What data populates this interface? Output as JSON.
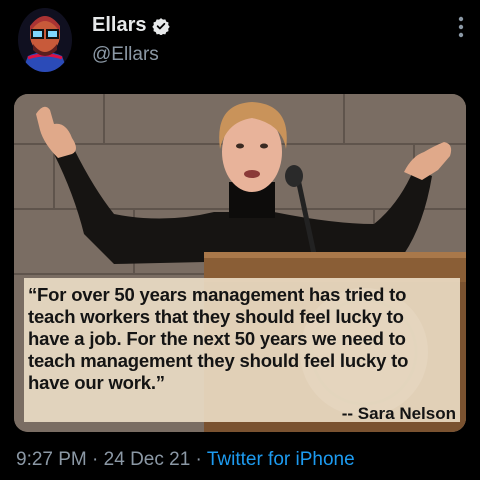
{
  "author": {
    "display_name": "Ellars",
    "handle": "@Ellars",
    "verified": true
  },
  "icons": {
    "verified": "verified-badge-icon",
    "more": "more-vertical-icon"
  },
  "media": {
    "quote": "“For over 50 years management has tried to\nteach workers that they should feel lucky to\nhave a job. For the next 50 years we need to\nteach management they should feel lucky to\nhave our work.”",
    "attribution": "-- Sara Nelson",
    "seal_text": "INDUSTRIAL"
  },
  "meta": {
    "time": "9:27 PM",
    "separator": " · ",
    "date": "24 Dec 21",
    "source": "Twitter for iPhone"
  },
  "colors": {
    "background": "#000000",
    "secondary_text": "#8b98a5",
    "link": "#1d9bf0",
    "verified_badge": "#e7e9ea"
  }
}
